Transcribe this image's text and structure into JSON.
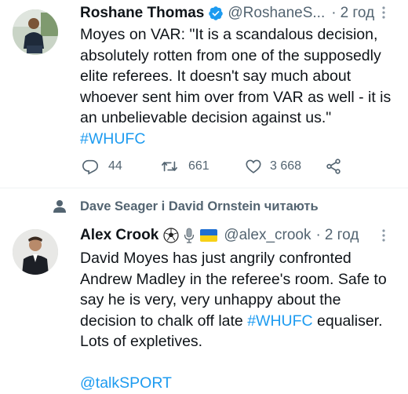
{
  "tweet1": {
    "name": "Roshane Thomas",
    "handle": "@RoshaneS...",
    "sep": "·",
    "time": "2 год",
    "lines": [
      "Moyes on VAR: \"It is a scandalous decision,",
      "absolutely rotten from one of the supposedly",
      "elite referees. It doesn't say much about",
      "whoever sent him over from VAR as well - it is",
      "an unbelievable decision against us.\""
    ],
    "hashtag": "#WHUFC",
    "replies": "44",
    "retweets": "661",
    "likes": "3 668"
  },
  "social_context": {
    "text": "Dave Seager і David Ornstein читають"
  },
  "tweet2": {
    "name": "Alex Crook",
    "handle": "@alex_crook",
    "sep": "·",
    "time": "2 год",
    "line1": "David Moyes has just angrily confronted",
    "line2": "Andrew Madley in the referee's room. Safe to",
    "line3": "say he is very, very unhappy about the",
    "line4_pre": "decision to chalk off late ",
    "line4_tag": "#WHUFC",
    "line4_post": " equaliser.",
    "line5": "Lots of expletives.",
    "mention": "@talkSPORT"
  },
  "icons": {
    "verified": "verified-badge-icon",
    "more": "more-dots-icon",
    "reply": "reply-icon",
    "retweet": "retweet-icon",
    "like": "heart-icon",
    "share": "share-icon",
    "person": "person-icon",
    "soccer": "soccer-ball-emoji",
    "mic": "microphone-emoji",
    "flag": "ukraine-flag-emoji"
  },
  "colors": {
    "link": "#1d9bf0",
    "verified": "#1d9bf0",
    "muted": "#536471",
    "text": "#0f1419",
    "divider": "#eff3f4"
  }
}
